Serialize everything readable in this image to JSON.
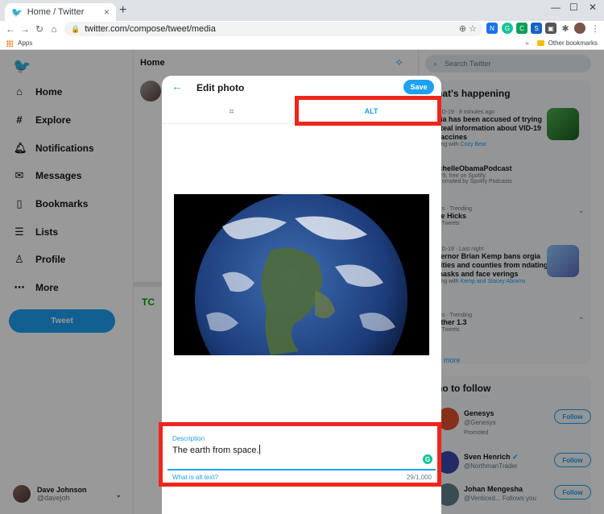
{
  "browser": {
    "tab_title": "Home / Twitter",
    "url": "twitter.com/compose/tweet/media",
    "apps_label": "Apps",
    "other_bookmarks": "Other bookmarks"
  },
  "nav": {
    "items": [
      {
        "label": "Home",
        "icon": "home-icon"
      },
      {
        "label": "Explore",
        "icon": "hashtag-icon"
      },
      {
        "label": "Notifications",
        "icon": "bell-icon"
      },
      {
        "label": "Messages",
        "icon": "envelope-icon"
      },
      {
        "label": "Bookmarks",
        "icon": "bookmark-icon"
      },
      {
        "label": "Lists",
        "icon": "list-icon"
      },
      {
        "label": "Profile",
        "icon": "person-icon"
      },
      {
        "label": "More",
        "icon": "more-icon"
      }
    ],
    "tweet_button": "Tweet"
  },
  "account": {
    "name": "Dave Johnson",
    "handle": "@davejoh"
  },
  "center": {
    "title": "Home"
  },
  "right": {
    "search_placeholder": "Search Twitter",
    "trends_title": "hat's happening",
    "trends": [
      {
        "meta": "VID-19 · 8 minutes ago",
        "title": "sia has been accused of trying steal information about VID-19 vaccines",
        "footer_prefix": "ding with",
        "footer_link": "Cozy Bear"
      },
      {
        "meta": "",
        "title": "ichelleObamaPodcast",
        "footer_prefix": "/ 29, free on Spotify.",
        "footer_link": "",
        "footer2": "Promoted by Spotify Podcasts"
      },
      {
        "meta": "tics · Trending",
        "title": "pe Hicks",
        "footer_prefix": "K Tweets",
        "footer_link": ""
      },
      {
        "meta": "VID-19 · Last night",
        "title": "vernor Brian Kemp bans orgia cities and counties from ndating masks and face verings",
        "footer_prefix": "ding with",
        "footer_link": "Kemp and Stacey Abrams"
      },
      {
        "meta": "tics · Trending",
        "title": "other 1.3",
        "footer_prefix": "K Tweets",
        "footer_link": ""
      }
    ],
    "show_more": "w more",
    "who_title": "ho to follow",
    "follow_label": "Follow",
    "follows": [
      {
        "name": "Genesys",
        "handle": "@Genesys",
        "extra": "Promoted"
      },
      {
        "name": "Sven Henrich",
        "handle": "@NorthmanTrader",
        "extra": ""
      },
      {
        "name": "Johan Mengesha",
        "handle": "@Venticed...",
        "extra": "Follows you"
      }
    ]
  },
  "modal": {
    "title": "Edit photo",
    "save_label": "Save",
    "alt_tab": "ALT",
    "description_label": "Description",
    "description_value": "The earth from space.",
    "alt_help": "What is alt text?",
    "char_count": "29/1,000"
  },
  "colors": {
    "brand": "#1da1f2",
    "highlight": "#f0241c"
  }
}
